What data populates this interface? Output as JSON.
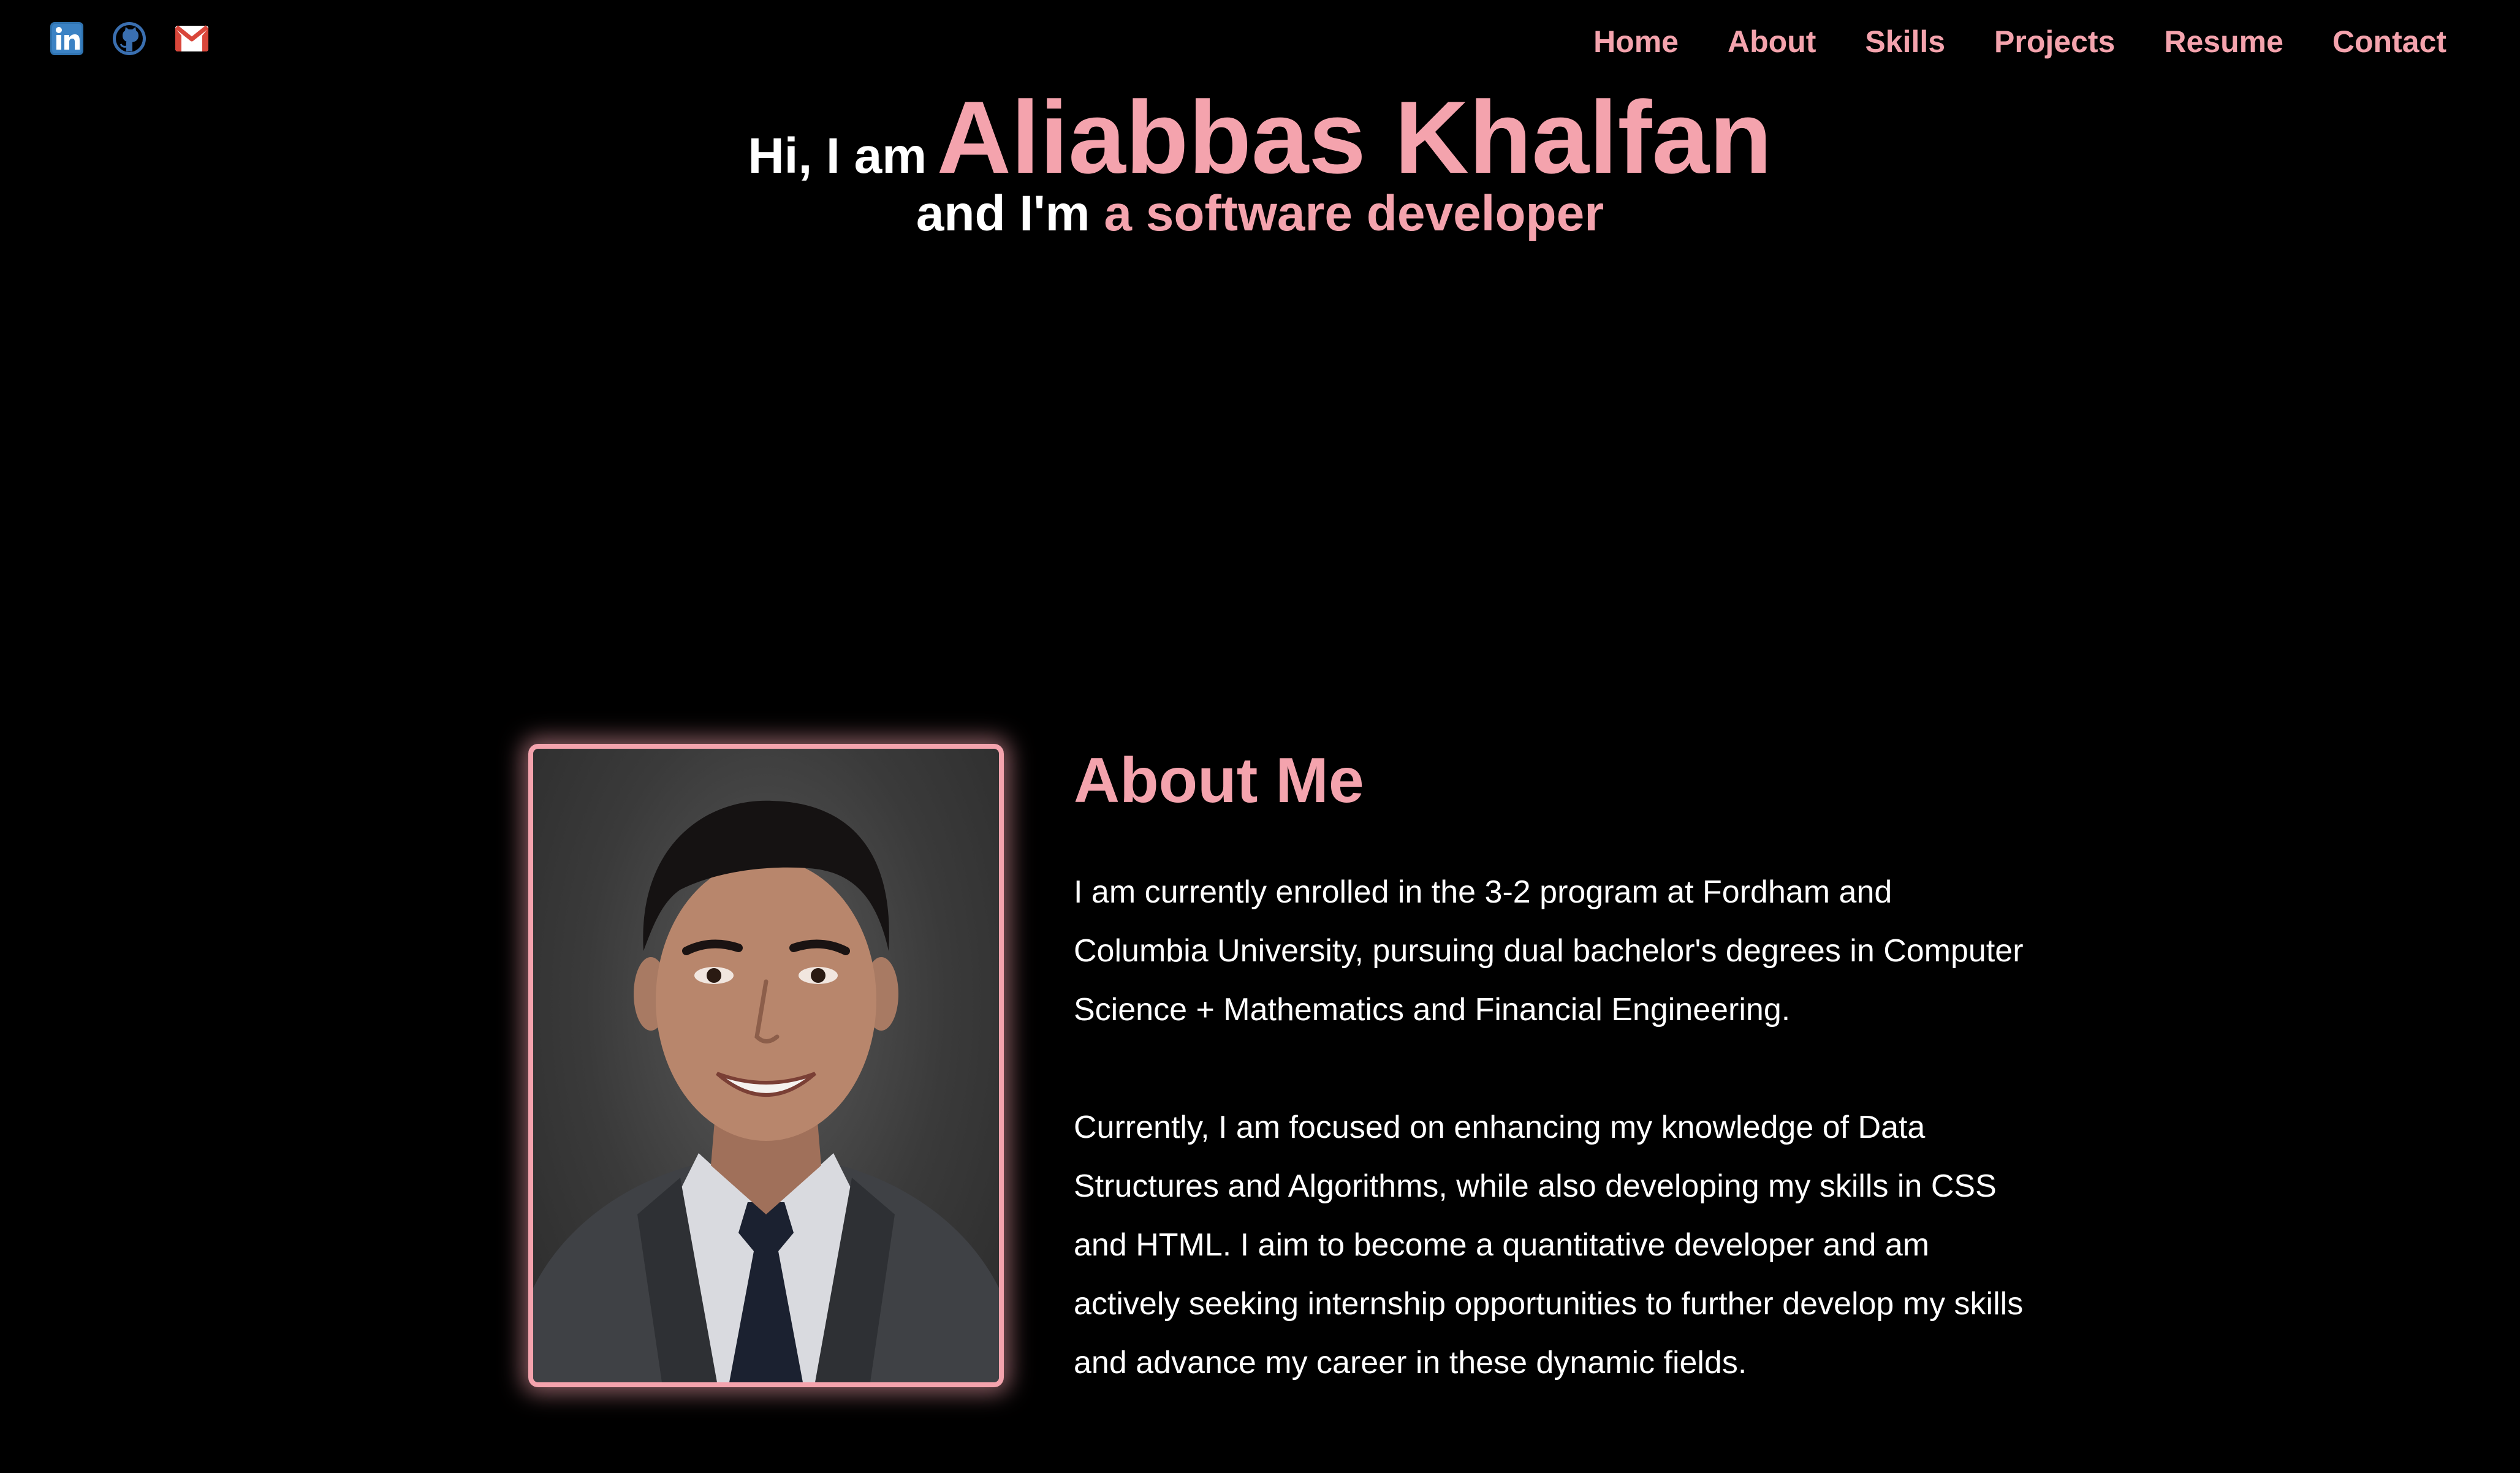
{
  "social": {
    "linkedin_icon": "linkedin-icon",
    "github_icon": "github-icon",
    "gmail_icon": "gmail-icon"
  },
  "nav": {
    "items": [
      "Home",
      "About",
      "Skills",
      "Projects",
      "Resume",
      "Contact"
    ]
  },
  "hero": {
    "greeting": "Hi, I am",
    "name": "Aliabbas Khalfan",
    "role_prefix": "and I'm",
    "role": "a software developer"
  },
  "about": {
    "heading": "About Me",
    "paragraph1": "I am currently enrolled in the 3-2 program at Fordham and Columbia University, pursuing dual bachelor's degrees in Computer Science + Mathematics and Financial Engineering.",
    "paragraph2": "Currently, I am focused on enhancing my knowledge of Data Structures and Algorithms, while also developing my skills in CSS and HTML. I aim to become a quantitative developer and am actively seeking internship opportunities to further develop my skills and advance my career in these dynamic fields."
  },
  "colors": {
    "background": "#000000",
    "accent": "#f4a3ad",
    "text": "#ffffff"
  }
}
